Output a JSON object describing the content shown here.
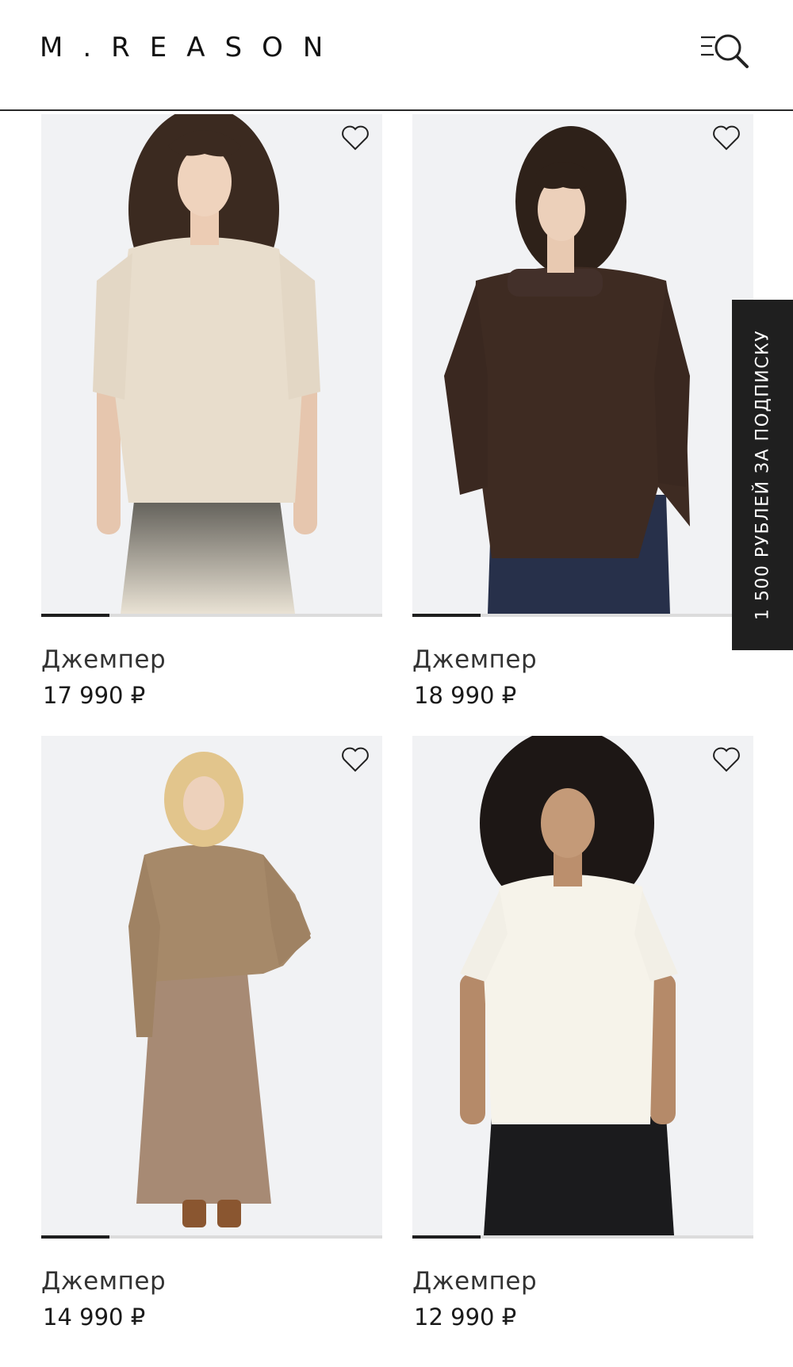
{
  "header": {
    "logo": "M.REASON",
    "menu_search_icon": "menu-search-icon"
  },
  "promo": {
    "label": "1 500 РУБЛЕЙ ЗА ПОДПИСКУ"
  },
  "products": [
    {
      "name": "Джемпер",
      "price": "17 990 ₽",
      "favorite_icon": "heart-outline-icon",
      "image": "woman-curly-hair-beige-boucle-short-sleeve-sweater-ombre-skirt",
      "slide_progress": 0.2
    },
    {
      "name": "Джемпер",
      "price": "18 990 ₽",
      "favorite_icon": "heart-outline-icon",
      "image": "woman-dark-curly-hair-brown-cutout-sweater-navy-trousers",
      "slide_progress": 0.2
    },
    {
      "name": "Джемпер",
      "price": "14 990 ₽",
      "favorite_icon": "heart-outline-icon",
      "image": "blonde-woman-camel-sweater-satin-midi-skirt",
      "slide_progress": 0.2
    },
    {
      "name": "Джемпер",
      "price": "12 990 ₽",
      "favorite_icon": "heart-outline-icon",
      "image": "woman-black-curly-hair-white-knit-vest-leather-pants",
      "slide_progress": 0.2
    }
  ],
  "colors": {
    "accent": "#1f1f1f",
    "progress_track": "#dcdcdc"
  }
}
